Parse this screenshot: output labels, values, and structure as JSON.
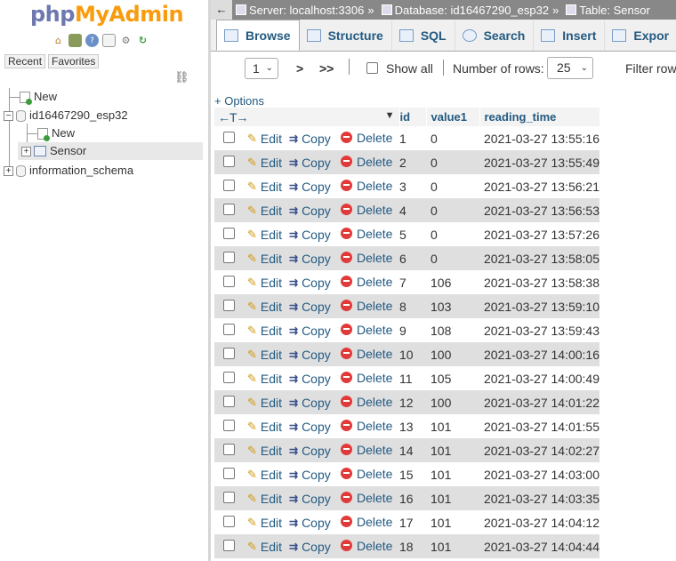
{
  "nav": {
    "logo_php": "php",
    "logo_rest": "MyAdmin",
    "quick_icons": [
      "home-icon",
      "exit-icon",
      "help-icon",
      "docs-icon",
      "settings-icon",
      "reload-icon"
    ],
    "tabs": [
      "Recent",
      "Favorites"
    ],
    "tree": [
      {
        "label": "New"
      },
      {
        "label": "id16467290_esp32"
      },
      {
        "label": "New"
      },
      {
        "label": "Sensor"
      },
      {
        "label": "information_schema"
      }
    ]
  },
  "breadcrumb": {
    "server": "Server: localhost:3306",
    "database": "Database: id16467290_esp32",
    "table": "Table: Sensor",
    "separator": "»"
  },
  "tabs": [
    "Browse",
    "Structure",
    "SQL",
    "Search",
    "Insert",
    "Expor"
  ],
  "pager": {
    "page": "1",
    "next": ">",
    "last": ">>",
    "show_all": "Show all",
    "rows_label": "Number of rows:",
    "rows_value": "25",
    "filter_label": "Filter rows"
  },
  "options_label": "+ Options",
  "table": {
    "headers": [
      "id",
      "value1",
      "reading_time"
    ],
    "actions": {
      "edit": "Edit",
      "copy": "Copy",
      "delete": "Delete"
    },
    "rows": [
      {
        "id": "1",
        "value1": "0",
        "reading_time": "2021-03-27 13:55:16"
      },
      {
        "id": "2",
        "value1": "0",
        "reading_time": "2021-03-27 13:55:49"
      },
      {
        "id": "3",
        "value1": "0",
        "reading_time": "2021-03-27 13:56:21"
      },
      {
        "id": "4",
        "value1": "0",
        "reading_time": "2021-03-27 13:56:53"
      },
      {
        "id": "5",
        "value1": "0",
        "reading_time": "2021-03-27 13:57:26"
      },
      {
        "id": "6",
        "value1": "0",
        "reading_time": "2021-03-27 13:58:05"
      },
      {
        "id": "7",
        "value1": "106",
        "reading_time": "2021-03-27 13:58:38"
      },
      {
        "id": "8",
        "value1": "103",
        "reading_time": "2021-03-27 13:59:10"
      },
      {
        "id": "9",
        "value1": "108",
        "reading_time": "2021-03-27 13:59:43"
      },
      {
        "id": "10",
        "value1": "100",
        "reading_time": "2021-03-27 14:00:16"
      },
      {
        "id": "11",
        "value1": "105",
        "reading_time": "2021-03-27 14:00:49"
      },
      {
        "id": "12",
        "value1": "100",
        "reading_time": "2021-03-27 14:01:22"
      },
      {
        "id": "13",
        "value1": "101",
        "reading_time": "2021-03-27 14:01:55"
      },
      {
        "id": "14",
        "value1": "101",
        "reading_time": "2021-03-27 14:02:27"
      },
      {
        "id": "15",
        "value1": "101",
        "reading_time": "2021-03-27 14:03:00"
      },
      {
        "id": "16",
        "value1": "101",
        "reading_time": "2021-03-27 14:03:35"
      },
      {
        "id": "17",
        "value1": "101",
        "reading_time": "2021-03-27 14:04:12"
      },
      {
        "id": "18",
        "value1": "101",
        "reading_time": "2021-03-27 14:04:44"
      }
    ]
  }
}
